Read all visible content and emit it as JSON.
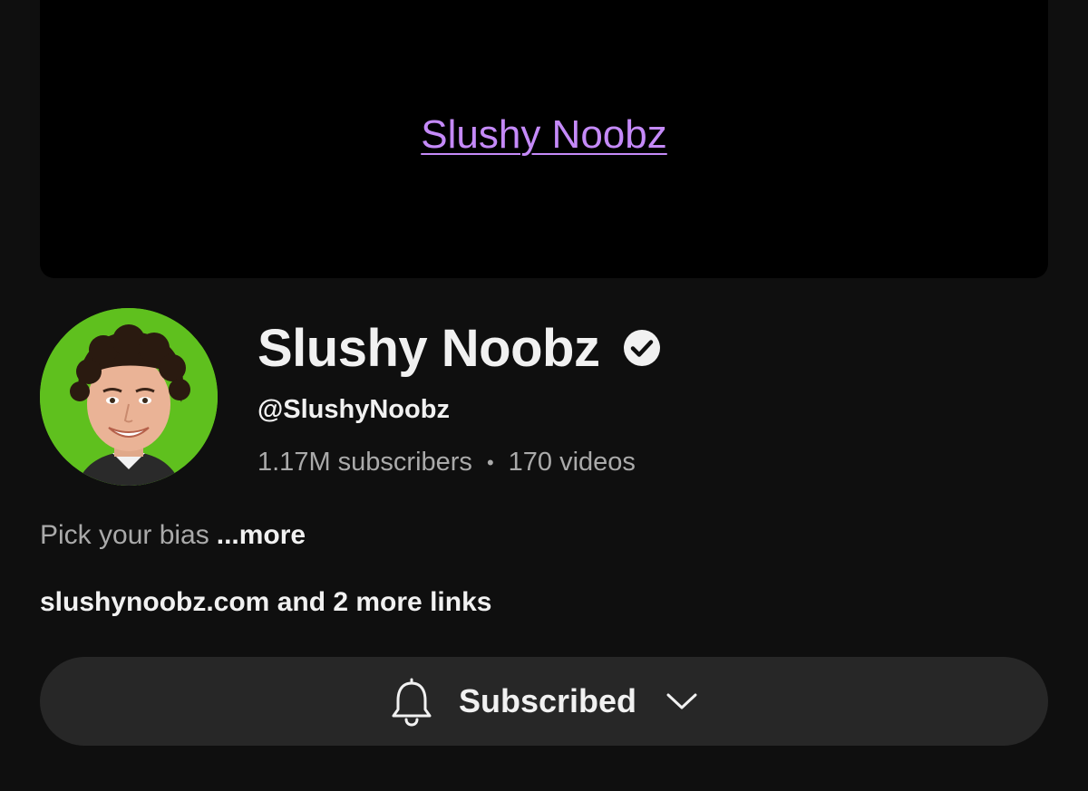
{
  "banner": {
    "link_text": "Slushy Noobz"
  },
  "channel": {
    "name": "Slushy Noobz",
    "handle": "@SlushyNoobz",
    "subscribers": "1.17M subscribers",
    "separator": "•",
    "videos": "170 videos",
    "verified_icon": "verified-check-icon",
    "avatar_bg_color": "#5fc01e"
  },
  "about": {
    "description": "Pick your bias",
    "more_label": "...more",
    "links_text": "slushynoobz.com and 2 more links"
  },
  "subscribe": {
    "label": "Subscribed",
    "bell_icon": "bell-icon",
    "dropdown_icon": "chevron-down-icon"
  },
  "colors": {
    "background": "#0f0f0f",
    "banner": "#000000",
    "link_purple": "#c58af9",
    "button_bg": "#272727",
    "secondary_text": "#aaaaaa"
  }
}
